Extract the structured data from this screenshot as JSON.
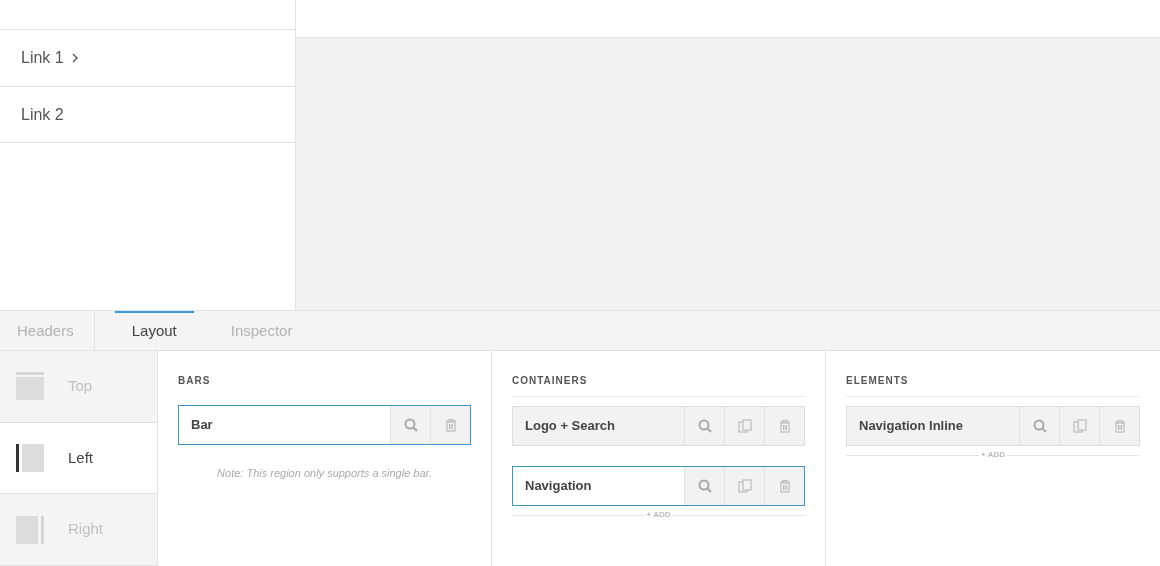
{
  "preview": {
    "links": [
      {
        "label": "Link 1",
        "chevron": true
      },
      {
        "label": "Link 2",
        "chevron": false
      }
    ]
  },
  "tabs": [
    {
      "label": "Headers",
      "selected": false
    },
    {
      "label": "Layout",
      "selected": true
    },
    {
      "label": "Inspector",
      "selected": false
    }
  ],
  "regions": [
    {
      "label": "Top",
      "kind": "top",
      "selected": false
    },
    {
      "label": "Left",
      "kind": "left",
      "selected": true
    },
    {
      "label": "Right",
      "kind": "right",
      "selected": false
    }
  ],
  "sections": [
    {
      "heading": "BARS",
      "divided": false,
      "items": [
        {
          "label": "Bar",
          "selected": true,
          "actions": [
            {
              "kind": "search"
            },
            {
              "kind": "delete"
            }
          ]
        }
      ],
      "note": "*Note:* This region only supports a single bar."
    },
    {
      "heading": "CONTAINERS",
      "divided": true,
      "items": [
        {
          "label": "Logo + Search",
          "selected": false,
          "actions": [
            {
              "kind": "search"
            },
            {
              "kind": "duplicate"
            },
            {
              "kind": "delete"
            }
          ]
        },
        {
          "label": "Navigation",
          "selected": true,
          "actions": [
            {
              "kind": "search"
            },
            {
              "kind": "duplicate"
            },
            {
              "kind": "delete"
            }
          ]
        }
      ],
      "add": "+ ADD"
    },
    {
      "heading": "ELEMENTS",
      "divided": true,
      "items": [
        {
          "label": "Navigation Inline",
          "selected": false,
          "actions": [
            {
              "kind": "search"
            },
            {
              "kind": "duplicate"
            },
            {
              "kind": "delete"
            }
          ]
        }
      ],
      "add": "+ ADD"
    }
  ]
}
